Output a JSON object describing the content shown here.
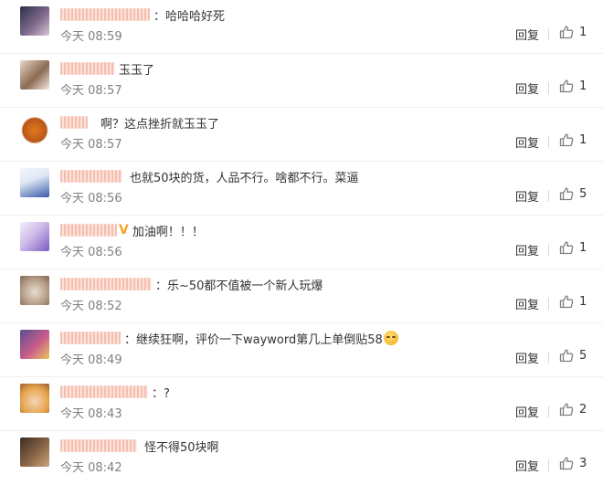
{
  "comments": [
    {
      "username": "",
      "name_color": "#eb7350",
      "text": "：哈哈哈好死",
      "time": "今天 08:59",
      "reply": "回复",
      "likes": "1",
      "avatar": {
        "icon": "avatar-dark-hair-anime",
        "colors": [
          "#2a2f4a",
          "#7f6a8c",
          "#d8c6d4"
        ]
      }
    },
    {
      "username": "",
      "name_color": "#eb7350",
      "text": "玉玉了",
      "time": "今天 08:57",
      "reply": "回复",
      "likes": "1",
      "avatar": {
        "icon": "avatar-anime-girl",
        "colors": [
          "#e9d7c6",
          "#8b6a52",
          "#f4e9df"
        ]
      }
    },
    {
      "username": "",
      "name_color": "#eb7350",
      "text": "啊？这点挫折就玉玉了",
      "time": "今天 08:57",
      "reply": "回复",
      "likes": "1",
      "avatar": {
        "icon": "avatar-orange-bear",
        "colors": [
          "#ffffff",
          "#e07a1f",
          "#b9561a"
        ]
      }
    },
    {
      "username": "",
      "name_color": "#eb7350",
      "text": "也就50块的货，人品不行。啥都不行。菜逼",
      "time": "今天 08:56",
      "reply": "回复",
      "likes": "5",
      "avatar": {
        "icon": "avatar-blue-figure",
        "colors": [
          "#dfe8f5",
          "#3b5aa8",
          "#f1f4fb"
        ]
      }
    },
    {
      "username": "",
      "name_color": "#eb7350",
      "badge": "V",
      "text": "加油啊！！！",
      "time": "今天 08:56",
      "reply": "回复",
      "likes": "1",
      "avatar": {
        "icon": "avatar-purple-hair",
        "colors": [
          "#cdbbe8",
          "#7d5bbd",
          "#f3eefb"
        ]
      }
    },
    {
      "username": "",
      "name_color": "#eb7350",
      "text": "：乐~50都不值被一个新人玩爆",
      "time": "今天 08:52",
      "reply": "回复",
      "likes": "1",
      "avatar": {
        "icon": "avatar-cat",
        "colors": [
          "#e8ddd2",
          "#b59b86",
          "#7a6552"
        ]
      }
    },
    {
      "username": "",
      "name_color": "#eb7350",
      "text": "：继续狂啊，评价一下wayword第几上单倒贴58",
      "emoji": "smug-face-emoji",
      "time": "今天 08:49",
      "reply": "回复",
      "likes": "5",
      "avatar": {
        "icon": "avatar-flowers",
        "colors": [
          "#5a4e8f",
          "#c95c8c",
          "#e9c65a"
        ]
      }
    },
    {
      "username": "",
      "name_color": "#eb7350",
      "text": "：?",
      "time": "今天 08:43",
      "reply": "回复",
      "likes": "2",
      "avatar": {
        "icon": "avatar-chibi",
        "colors": [
          "#f4d6b8",
          "#e6a34c",
          "#9b5a2c"
        ]
      }
    },
    {
      "username": "",
      "name_color": "#eb7350",
      "text": "怪不得50块啊",
      "time": "今天 08:42",
      "reply": "回复",
      "likes": "3",
      "avatar": {
        "icon": "avatar-dark-character",
        "colors": [
          "#3b2d24",
          "#8a6547",
          "#c9a57d"
        ]
      }
    }
  ]
}
